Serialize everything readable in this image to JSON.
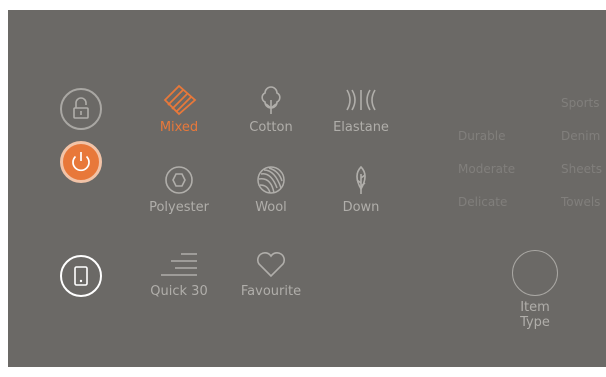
{
  "controls": {
    "lock_icon": "padlock-open-icon",
    "power_icon": "power-icon",
    "phone_icon": "smartphone-icon"
  },
  "programs": [
    {
      "label": "Mixed",
      "icon": "mixed-fabric-icon",
      "active": true
    },
    {
      "label": "Cotton",
      "icon": "cotton-icon",
      "active": false
    },
    {
      "label": "Elastane",
      "icon": "elastane-icon",
      "active": false
    },
    {
      "label": "Polyester",
      "icon": "polyester-icon",
      "active": false
    },
    {
      "label": "Wool",
      "icon": "wool-icon",
      "active": false
    },
    {
      "label": "Down",
      "icon": "feather-icon",
      "active": false
    },
    {
      "label": "Quick 30",
      "icon": "speed-lines-icon",
      "active": false
    },
    {
      "label": "Favourite",
      "icon": "heart-icon",
      "active": false
    }
  ],
  "item_type_options": [
    "Sports",
    "Durable",
    "Denim",
    "Moderate",
    "Sheets",
    "Delicate",
    "Towels"
  ],
  "item_type_button": {
    "line1": "Item",
    "line2": "Type"
  },
  "colors": {
    "background": "#6b6966",
    "accent": "#e8783a",
    "icon": "#b0aeaa",
    "white": "#ffffff",
    "faint": "#817f7c"
  }
}
